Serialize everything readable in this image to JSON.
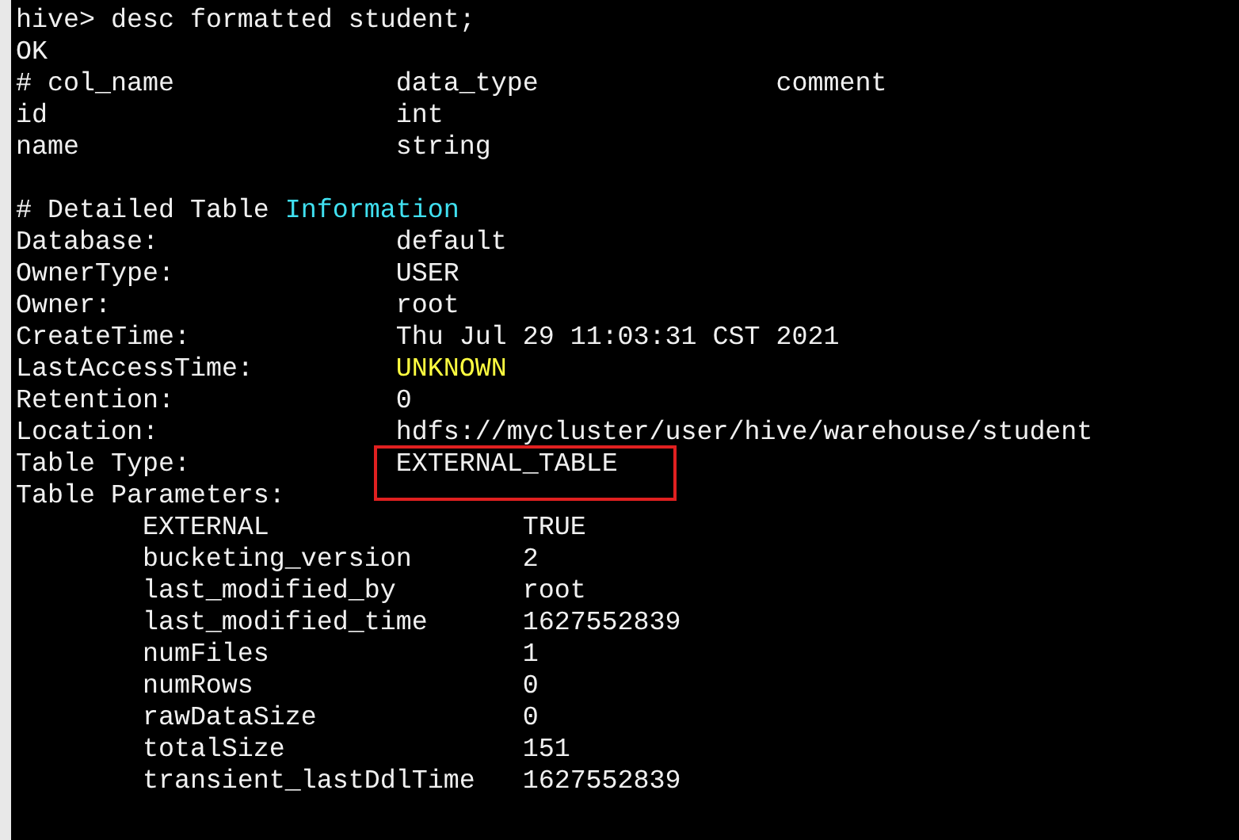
{
  "terminal": {
    "lines": [
      {
        "kind": "text",
        "parts": [
          {
            "text": "hive> desc formatted student;"
          }
        ]
      },
      {
        "kind": "text",
        "parts": [
          {
            "text": "OK"
          }
        ]
      },
      {
        "kind": "row",
        "cells": [
          "# col_name",
          "data_type",
          "comment"
        ]
      },
      {
        "kind": "row",
        "cells": [
          "id",
          "int"
        ]
      },
      {
        "kind": "row",
        "cells": [
          "name",
          "string"
        ]
      },
      {
        "kind": "blank"
      },
      {
        "kind": "text",
        "parts": [
          {
            "text": "# Detailed Table "
          },
          {
            "text": "Information",
            "color": "#40e0f0"
          }
        ]
      },
      {
        "kind": "row",
        "cells": [
          "Database:",
          "default"
        ]
      },
      {
        "kind": "row",
        "cells": [
          "OwnerType:",
          "USER"
        ]
      },
      {
        "kind": "row",
        "cells": [
          "Owner:",
          "root"
        ]
      },
      {
        "kind": "row",
        "cells": [
          "CreateTime:",
          "Thu Jul 29 11:03:31 CST 2021"
        ]
      },
      {
        "kind": "row",
        "cells": [
          "LastAccessTime:",
          "UNKNOWN"
        ],
        "color": "#ffff40"
      },
      {
        "kind": "row",
        "cells": [
          "Retention:",
          "0"
        ]
      },
      {
        "kind": "row",
        "cells": [
          "Location:",
          "hdfs://mycluster/user/hive/warehouse/student"
        ]
      },
      {
        "kind": "row",
        "cells": [
          "Table Type:",
          "EXTERNAL_TABLE"
        ],
        "framed": true
      },
      {
        "kind": "text",
        "parts": [
          {
            "text": "Table Parameters:"
          }
        ]
      },
      {
        "kind": "param",
        "cells": [
          "EXTERNAL",
          "TRUE"
        ]
      },
      {
        "kind": "param",
        "cells": [
          "bucketing_version",
          "2"
        ]
      },
      {
        "kind": "param",
        "cells": [
          "last_modified_by",
          "root"
        ]
      },
      {
        "kind": "param",
        "cells": [
          "last_modified_time",
          "1627552839"
        ]
      },
      {
        "kind": "param",
        "cells": [
          "numFiles",
          "1"
        ]
      },
      {
        "kind": "param",
        "cells": [
          "numRows",
          "0"
        ]
      },
      {
        "kind": "param",
        "cells": [
          "rawDataSize",
          "0"
        ]
      },
      {
        "kind": "param",
        "cells": [
          "totalSize",
          "151"
        ]
      },
      {
        "kind": "param",
        "cells": [
          "transient_lastDdlTime",
          "1627552839"
        ]
      }
    ]
  }
}
